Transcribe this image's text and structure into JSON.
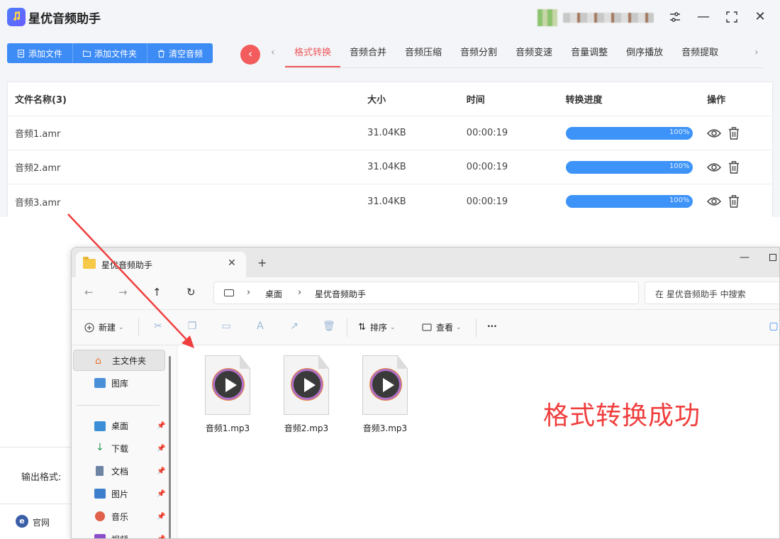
{
  "app": {
    "title": "星优音频助手",
    "toolbar": {
      "add_file": "添加文件",
      "add_folder": "添加文件夹",
      "clear": "清空音频"
    },
    "tabs": [
      "格式转换",
      "音频合并",
      "音频压缩",
      "音频分割",
      "音频变速",
      "音量调整",
      "倒序播放",
      "音频提取"
    ],
    "active_tab": "格式转换",
    "table": {
      "headers": {
        "name": "文件名称(3)",
        "size": "大小",
        "time": "时间",
        "progress": "转换进度",
        "actions": "操作"
      },
      "rows": [
        {
          "name": "音频1.amr",
          "size": "31.04KB",
          "time": "00:00:19",
          "progress": "100%"
        },
        {
          "name": "音频2.amr",
          "size": "31.04KB",
          "time": "00:00:19",
          "progress": "100%"
        },
        {
          "name": "音频3.amr",
          "size": "31.04KB",
          "time": "00:00:19",
          "progress": "100%"
        }
      ]
    },
    "output_format_label": "输出格式:",
    "footer_label": "官网"
  },
  "explorer": {
    "tab_title": "星优音频助手",
    "breadcrumb": [
      "桌面",
      "星优音频助手"
    ],
    "search_placeholder": "在 星优音频助手 中搜索",
    "commands": {
      "new": "新建",
      "sort": "排序",
      "view": "查看",
      "more": "···"
    },
    "sidebar": [
      {
        "label": "主文件夹",
        "icon": "home-icon",
        "selected": true
      },
      {
        "label": "图库",
        "icon": "gallery-icon"
      },
      {
        "label": "桌面",
        "icon": "desktop-icon",
        "pinned": true
      },
      {
        "label": "下载",
        "icon": "download-icon",
        "pinned": true
      },
      {
        "label": "文档",
        "icon": "document-icon",
        "pinned": true
      },
      {
        "label": "图片",
        "icon": "pictures-icon",
        "pinned": true
      },
      {
        "label": "音乐",
        "icon": "music-icon",
        "pinned": true
      },
      {
        "label": "视频",
        "icon": "video-icon",
        "pinned": true
      }
    ],
    "files": [
      "音频1.mp3",
      "音频2.mp3",
      "音频3.mp3"
    ],
    "annotation": "格式转换成功"
  },
  "colors": {
    "accent_blue": "#3d8bf5",
    "active_tab_red": "#f0595b",
    "annotation_red": "#f03e3e",
    "progress_blue": "#3d93f8"
  }
}
